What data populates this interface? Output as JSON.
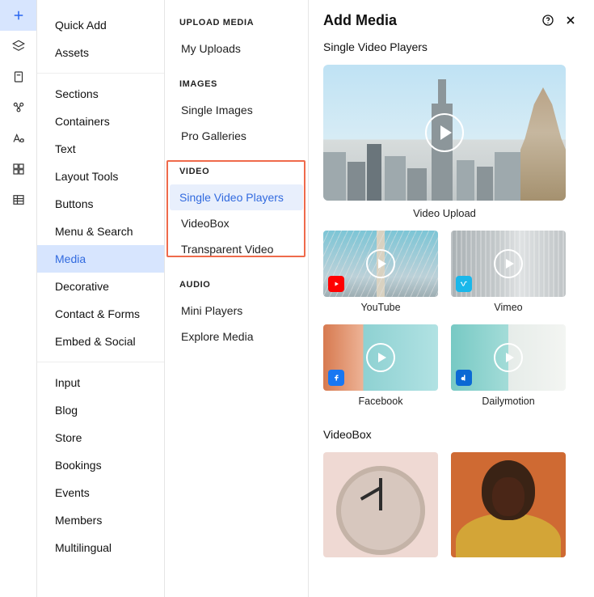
{
  "iconRail": {
    "items": [
      {
        "name": "add-icon",
        "semantic": "add"
      },
      {
        "name": "layers-icon",
        "semantic": "layers"
      },
      {
        "name": "page-icon",
        "semantic": "page"
      },
      {
        "name": "cluster-icon",
        "semantic": "apps"
      },
      {
        "name": "typography-icon",
        "semantic": "fonts"
      },
      {
        "name": "grid-icon",
        "semantic": "grid"
      },
      {
        "name": "table-icon",
        "semantic": "table"
      }
    ],
    "active": 0
  },
  "nav": {
    "groups": [
      {
        "items": [
          {
            "label": "Quick Add",
            "name": "nav-quick-add"
          },
          {
            "label": "Assets",
            "name": "nav-assets"
          }
        ]
      },
      {
        "items": [
          {
            "label": "Sections",
            "name": "nav-sections"
          },
          {
            "label": "Containers",
            "name": "nav-containers"
          },
          {
            "label": "Text",
            "name": "nav-text"
          },
          {
            "label": "Layout Tools",
            "name": "nav-layout-tools"
          },
          {
            "label": "Buttons",
            "name": "nav-buttons"
          },
          {
            "label": "Menu & Search",
            "name": "nav-menu-search"
          },
          {
            "label": "Media",
            "name": "nav-media",
            "active": true
          },
          {
            "label": "Decorative",
            "name": "nav-decorative"
          },
          {
            "label": "Contact & Forms",
            "name": "nav-contact-forms"
          },
          {
            "label": "Embed & Social",
            "name": "nav-embed-social"
          }
        ]
      },
      {
        "items": [
          {
            "label": "Input",
            "name": "nav-input"
          },
          {
            "label": "Blog",
            "name": "nav-blog"
          },
          {
            "label": "Store",
            "name": "nav-store"
          },
          {
            "label": "Bookings",
            "name": "nav-bookings"
          },
          {
            "label": "Events",
            "name": "nav-events"
          },
          {
            "label": "Members",
            "name": "nav-members"
          },
          {
            "label": "Multilingual",
            "name": "nav-multilingual"
          }
        ]
      }
    ]
  },
  "types": {
    "highlightedGroupIndex": 2,
    "groups": [
      {
        "heading": "UPLOAD MEDIA",
        "name": "types-upload-media",
        "items": [
          {
            "label": "My Uploads",
            "name": "types-my-uploads"
          }
        ]
      },
      {
        "heading": "IMAGES",
        "name": "types-images",
        "items": [
          {
            "label": "Single Images",
            "name": "types-single-images"
          },
          {
            "label": "Pro Galleries",
            "name": "types-pro-galleries"
          }
        ]
      },
      {
        "heading": "VIDEO",
        "name": "types-video",
        "items": [
          {
            "label": "Single Video Players",
            "name": "types-single-video-players",
            "active": true
          },
          {
            "label": "VideoBox",
            "name": "types-videobox"
          },
          {
            "label": "Transparent Video",
            "name": "types-transparent-video"
          }
        ]
      },
      {
        "heading": "AUDIO",
        "name": "types-audio",
        "items": [
          {
            "label": "Mini Players",
            "name": "types-mini-players"
          },
          {
            "label": "Explore Media",
            "name": "types-explore-media"
          }
        ]
      }
    ]
  },
  "content": {
    "title": "Add Media",
    "sections": {
      "svp": {
        "heading": "Single Video Players",
        "hero": {
          "caption": "Video Upload",
          "name": "media-card-video-upload"
        },
        "tiles": [
          {
            "caption": "YouTube",
            "name": "media-card-youtube",
            "brandColor": "#ff0000",
            "brandIcon": "yt"
          },
          {
            "caption": "Vimeo",
            "name": "media-card-vimeo",
            "brandColor": "#1ab7ea",
            "brandIcon": "vimeo"
          },
          {
            "caption": "Facebook",
            "name": "media-card-facebook",
            "brandColor": "#1877f2",
            "brandIcon": "fb"
          },
          {
            "caption": "Dailymotion",
            "name": "media-card-dailymotion",
            "brandColor": "#0b69d4",
            "brandIcon": "dm"
          }
        ]
      },
      "vb": {
        "heading": "VideoBox",
        "tiles": [
          {
            "name": "videobox-card-clock"
          },
          {
            "name": "videobox-card-portrait"
          }
        ]
      }
    }
  },
  "colors": {
    "accent": "#316adf",
    "selectionBg": "#d7e5fe",
    "highlightBorder": "#ef6a4b"
  }
}
